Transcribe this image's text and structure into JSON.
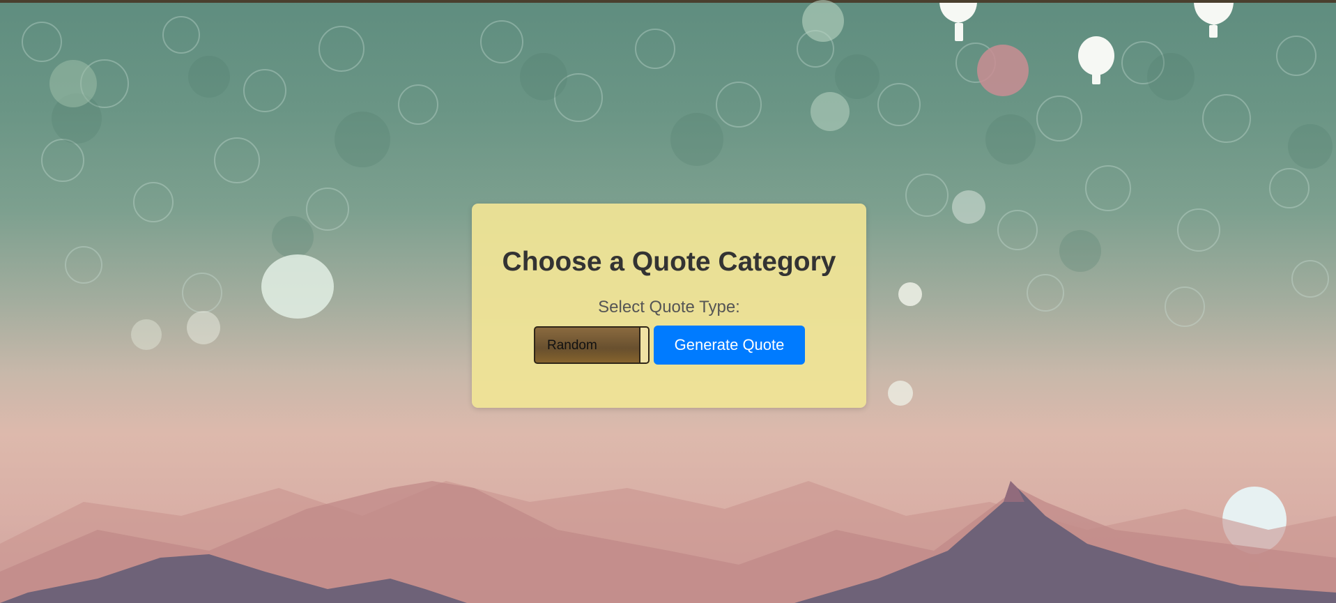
{
  "card": {
    "title": "Choose a Quote Category",
    "select_label": "Select Quote Type:",
    "selected_category": "Random",
    "button_label": "Generate Quote"
  },
  "colors": {
    "card_background": "#f0e496",
    "button_accent": "#007bff",
    "title_text": "#333333",
    "sky_top": "#5f8d7f",
    "sky_bottom": "#d9afa6"
  },
  "icons": [
    "balloon-icon"
  ]
}
